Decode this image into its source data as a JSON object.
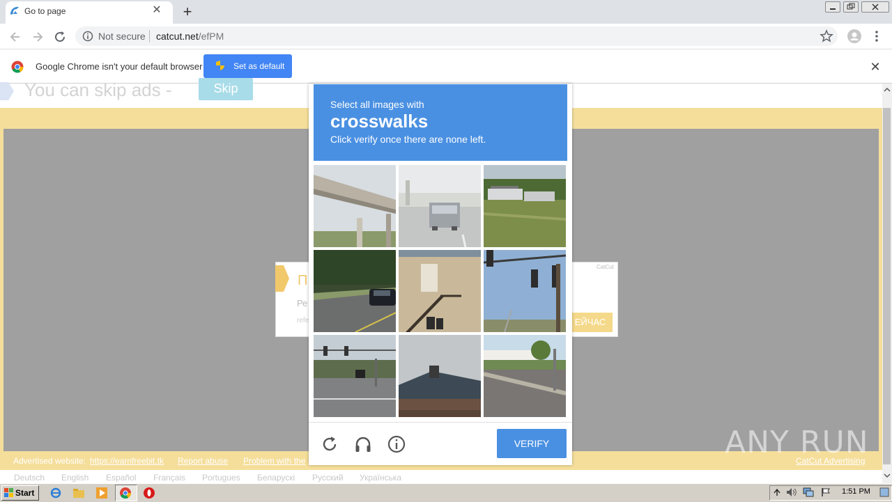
{
  "browser": {
    "tab_title": "Go to page",
    "not_secure": "Not secure",
    "url_domain": "catcut.net",
    "url_path": "/efPM",
    "infobar_text": "Google Chrome isn't your default browser",
    "set_default_label": "Set as default"
  },
  "page": {
    "skip_text": "You can skip ads  -",
    "skip_button": "Skip",
    "card_title": "П",
    "card_line1": "Ре",
    "card_line2": "refe",
    "card_brand": "CatCut",
    "card_button": "ЕЙЧАС",
    "footer": {
      "advertised": "Advertised website:",
      "advertised_link": "https://earnfreebit.tk",
      "report": "Report abuse",
      "problem": "Problem with the",
      "advertising": "CatCut Advertising"
    },
    "languages": [
      "Deutsch",
      "English",
      "Español",
      "Français",
      "Portugues",
      "Беларускі",
      "Русский",
      "Українська"
    ]
  },
  "captcha": {
    "line1": "Select all images with",
    "keyword": "crosswalks",
    "line3": "Click verify once there are none left.",
    "verify_label": "VERIFY",
    "tiles": [
      "overpass",
      "street-car",
      "boats-field",
      "road-car",
      "building-stairs",
      "traffic-lights",
      "intersection",
      "roof",
      "road-shops"
    ]
  },
  "watermark": "ANY RUN",
  "taskbar": {
    "start_label": "Start",
    "clock": "1:51 PM"
  },
  "colors": {
    "captcha_blue": "#4a90e2",
    "chrome_blue": "#4285f4",
    "page_yellow": "#f5de9a"
  }
}
